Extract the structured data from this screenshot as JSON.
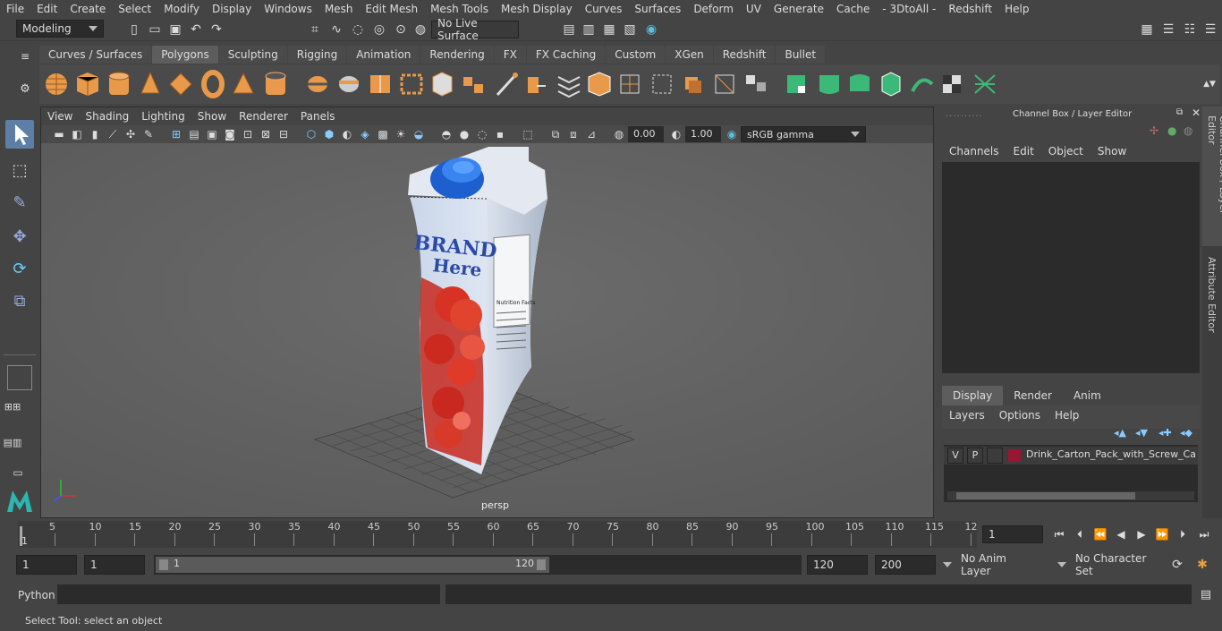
{
  "menu": [
    "File",
    "Edit",
    "Create",
    "Select",
    "Modify",
    "Display",
    "Windows",
    "Mesh",
    "Edit Mesh",
    "Mesh Tools",
    "Mesh Display",
    "Curves",
    "Surfaces",
    "Deform",
    "UV",
    "Generate",
    "Cache",
    "- 3DtoAll -",
    "Redshift",
    "Help"
  ],
  "status": {
    "mode": "Modeling",
    "live_surface": "No Live Surface"
  },
  "shelf_tabs": [
    "Curves / Surfaces",
    "Polygons",
    "Sculpting",
    "Rigging",
    "Animation",
    "Rendering",
    "FX",
    "FX Caching",
    "Custom",
    "XGen",
    "Redshift",
    "Bullet"
  ],
  "shelf_active": "Polygons",
  "viewport": {
    "menu": [
      "View",
      "Shading",
      "Lighting",
      "Show",
      "Renderer",
      "Panels"
    ],
    "exposure": "0.00",
    "gamma": "1.00",
    "colorspace": "sRGB gamma",
    "camera": "persp"
  },
  "model": {
    "brand_line1": "BRAND",
    "brand_line2": "Here",
    "label": "Nutrition Facts"
  },
  "channel_box": {
    "title": "Channel Box / Layer Editor",
    "menu": [
      "Channels",
      "Edit",
      "Object",
      "Show"
    ]
  },
  "layer_editor": {
    "tabs": [
      "Display",
      "Render",
      "Anim"
    ],
    "active_tab": "Display",
    "menu": [
      "Layers",
      "Options",
      "Help"
    ],
    "layer": {
      "v": "V",
      "p": "P",
      "name": "Drink_Carton_Pack_with_Screw_Cap_I",
      "color": "#9b1530"
    }
  },
  "side_tabs": [
    "Channel Box / Layer Editor",
    "Attribute Editor"
  ],
  "timeline": {
    "ticks": [
      "5",
      "10",
      "15",
      "20",
      "25",
      "30",
      "35",
      "40",
      "45",
      "50",
      "55",
      "60",
      "65",
      "70",
      "75",
      "80",
      "85",
      "90",
      "95",
      "100",
      "105",
      "110",
      "115",
      "12"
    ],
    "start_label": "1",
    "current_frame": "1"
  },
  "range": {
    "start": "1",
    "anim_start": "1",
    "slider_start": "1",
    "slider_end": "120",
    "end": "120",
    "anim_end": "200",
    "anim_layer": "No Anim Layer",
    "char_set": "No Character Set"
  },
  "command": {
    "lang": "Python"
  },
  "help_text": "Select Tool: select an object"
}
